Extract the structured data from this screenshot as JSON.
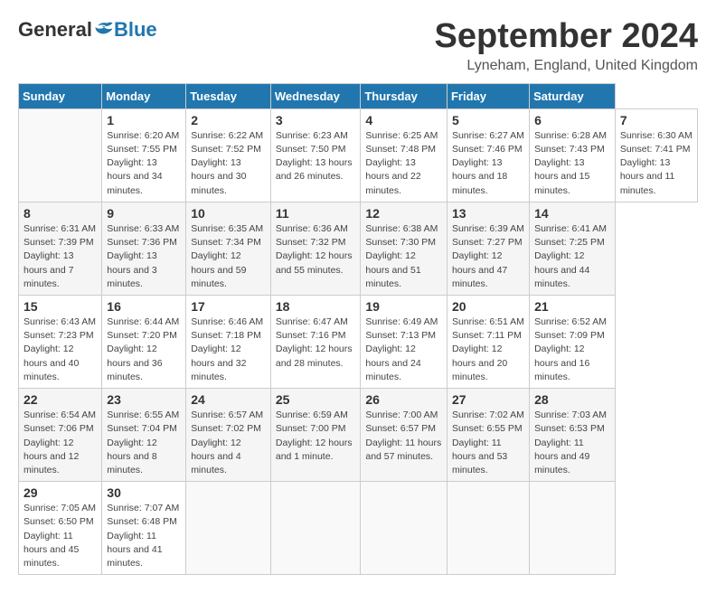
{
  "header": {
    "logo": {
      "general": "General",
      "blue": "Blue"
    },
    "title": "September 2024",
    "location": "Lyneham, England, United Kingdom"
  },
  "calendar": {
    "days_of_week": [
      "Sunday",
      "Monday",
      "Tuesday",
      "Wednesday",
      "Thursday",
      "Friday",
      "Saturday"
    ],
    "weeks": [
      [
        null,
        {
          "day": 1,
          "sunrise": "Sunrise: 6:20 AM",
          "sunset": "Sunset: 7:55 PM",
          "daylight": "Daylight: 13 hours and 34 minutes."
        },
        {
          "day": 2,
          "sunrise": "Sunrise: 6:22 AM",
          "sunset": "Sunset: 7:52 PM",
          "daylight": "Daylight: 13 hours and 30 minutes."
        },
        {
          "day": 3,
          "sunrise": "Sunrise: 6:23 AM",
          "sunset": "Sunset: 7:50 PM",
          "daylight": "Daylight: 13 hours and 26 minutes."
        },
        {
          "day": 4,
          "sunrise": "Sunrise: 6:25 AM",
          "sunset": "Sunset: 7:48 PM",
          "daylight": "Daylight: 13 hours and 22 minutes."
        },
        {
          "day": 5,
          "sunrise": "Sunrise: 6:27 AM",
          "sunset": "Sunset: 7:46 PM",
          "daylight": "Daylight: 13 hours and 18 minutes."
        },
        {
          "day": 6,
          "sunrise": "Sunrise: 6:28 AM",
          "sunset": "Sunset: 7:43 PM",
          "daylight": "Daylight: 13 hours and 15 minutes."
        },
        {
          "day": 7,
          "sunrise": "Sunrise: 6:30 AM",
          "sunset": "Sunset: 7:41 PM",
          "daylight": "Daylight: 13 hours and 11 minutes."
        }
      ],
      [
        {
          "day": 8,
          "sunrise": "Sunrise: 6:31 AM",
          "sunset": "Sunset: 7:39 PM",
          "daylight": "Daylight: 13 hours and 7 minutes."
        },
        {
          "day": 9,
          "sunrise": "Sunrise: 6:33 AM",
          "sunset": "Sunset: 7:36 PM",
          "daylight": "Daylight: 13 hours and 3 minutes."
        },
        {
          "day": 10,
          "sunrise": "Sunrise: 6:35 AM",
          "sunset": "Sunset: 7:34 PM",
          "daylight": "Daylight: 12 hours and 59 minutes."
        },
        {
          "day": 11,
          "sunrise": "Sunrise: 6:36 AM",
          "sunset": "Sunset: 7:32 PM",
          "daylight": "Daylight: 12 hours and 55 minutes."
        },
        {
          "day": 12,
          "sunrise": "Sunrise: 6:38 AM",
          "sunset": "Sunset: 7:30 PM",
          "daylight": "Daylight: 12 hours and 51 minutes."
        },
        {
          "day": 13,
          "sunrise": "Sunrise: 6:39 AM",
          "sunset": "Sunset: 7:27 PM",
          "daylight": "Daylight: 12 hours and 47 minutes."
        },
        {
          "day": 14,
          "sunrise": "Sunrise: 6:41 AM",
          "sunset": "Sunset: 7:25 PM",
          "daylight": "Daylight: 12 hours and 44 minutes."
        }
      ],
      [
        {
          "day": 15,
          "sunrise": "Sunrise: 6:43 AM",
          "sunset": "Sunset: 7:23 PM",
          "daylight": "Daylight: 12 hours and 40 minutes."
        },
        {
          "day": 16,
          "sunrise": "Sunrise: 6:44 AM",
          "sunset": "Sunset: 7:20 PM",
          "daylight": "Daylight: 12 hours and 36 minutes."
        },
        {
          "day": 17,
          "sunrise": "Sunrise: 6:46 AM",
          "sunset": "Sunset: 7:18 PM",
          "daylight": "Daylight: 12 hours and 32 minutes."
        },
        {
          "day": 18,
          "sunrise": "Sunrise: 6:47 AM",
          "sunset": "Sunset: 7:16 PM",
          "daylight": "Daylight: 12 hours and 28 minutes."
        },
        {
          "day": 19,
          "sunrise": "Sunrise: 6:49 AM",
          "sunset": "Sunset: 7:13 PM",
          "daylight": "Daylight: 12 hours and 24 minutes."
        },
        {
          "day": 20,
          "sunrise": "Sunrise: 6:51 AM",
          "sunset": "Sunset: 7:11 PM",
          "daylight": "Daylight: 12 hours and 20 minutes."
        },
        {
          "day": 21,
          "sunrise": "Sunrise: 6:52 AM",
          "sunset": "Sunset: 7:09 PM",
          "daylight": "Daylight: 12 hours and 16 minutes."
        }
      ],
      [
        {
          "day": 22,
          "sunrise": "Sunrise: 6:54 AM",
          "sunset": "Sunset: 7:06 PM",
          "daylight": "Daylight: 12 hours and 12 minutes."
        },
        {
          "day": 23,
          "sunrise": "Sunrise: 6:55 AM",
          "sunset": "Sunset: 7:04 PM",
          "daylight": "Daylight: 12 hours and 8 minutes."
        },
        {
          "day": 24,
          "sunrise": "Sunrise: 6:57 AM",
          "sunset": "Sunset: 7:02 PM",
          "daylight": "Daylight: 12 hours and 4 minutes."
        },
        {
          "day": 25,
          "sunrise": "Sunrise: 6:59 AM",
          "sunset": "Sunset: 7:00 PM",
          "daylight": "Daylight: 12 hours and 1 minute."
        },
        {
          "day": 26,
          "sunrise": "Sunrise: 7:00 AM",
          "sunset": "Sunset: 6:57 PM",
          "daylight": "Daylight: 11 hours and 57 minutes."
        },
        {
          "day": 27,
          "sunrise": "Sunrise: 7:02 AM",
          "sunset": "Sunset: 6:55 PM",
          "daylight": "Daylight: 11 hours and 53 minutes."
        },
        {
          "day": 28,
          "sunrise": "Sunrise: 7:03 AM",
          "sunset": "Sunset: 6:53 PM",
          "daylight": "Daylight: 11 hours and 49 minutes."
        }
      ],
      [
        {
          "day": 29,
          "sunrise": "Sunrise: 7:05 AM",
          "sunset": "Sunset: 6:50 PM",
          "daylight": "Daylight: 11 hours and 45 minutes."
        },
        {
          "day": 30,
          "sunrise": "Sunrise: 7:07 AM",
          "sunset": "Sunset: 6:48 PM",
          "daylight": "Daylight: 11 hours and 41 minutes."
        },
        null,
        null,
        null,
        null,
        null
      ]
    ]
  }
}
